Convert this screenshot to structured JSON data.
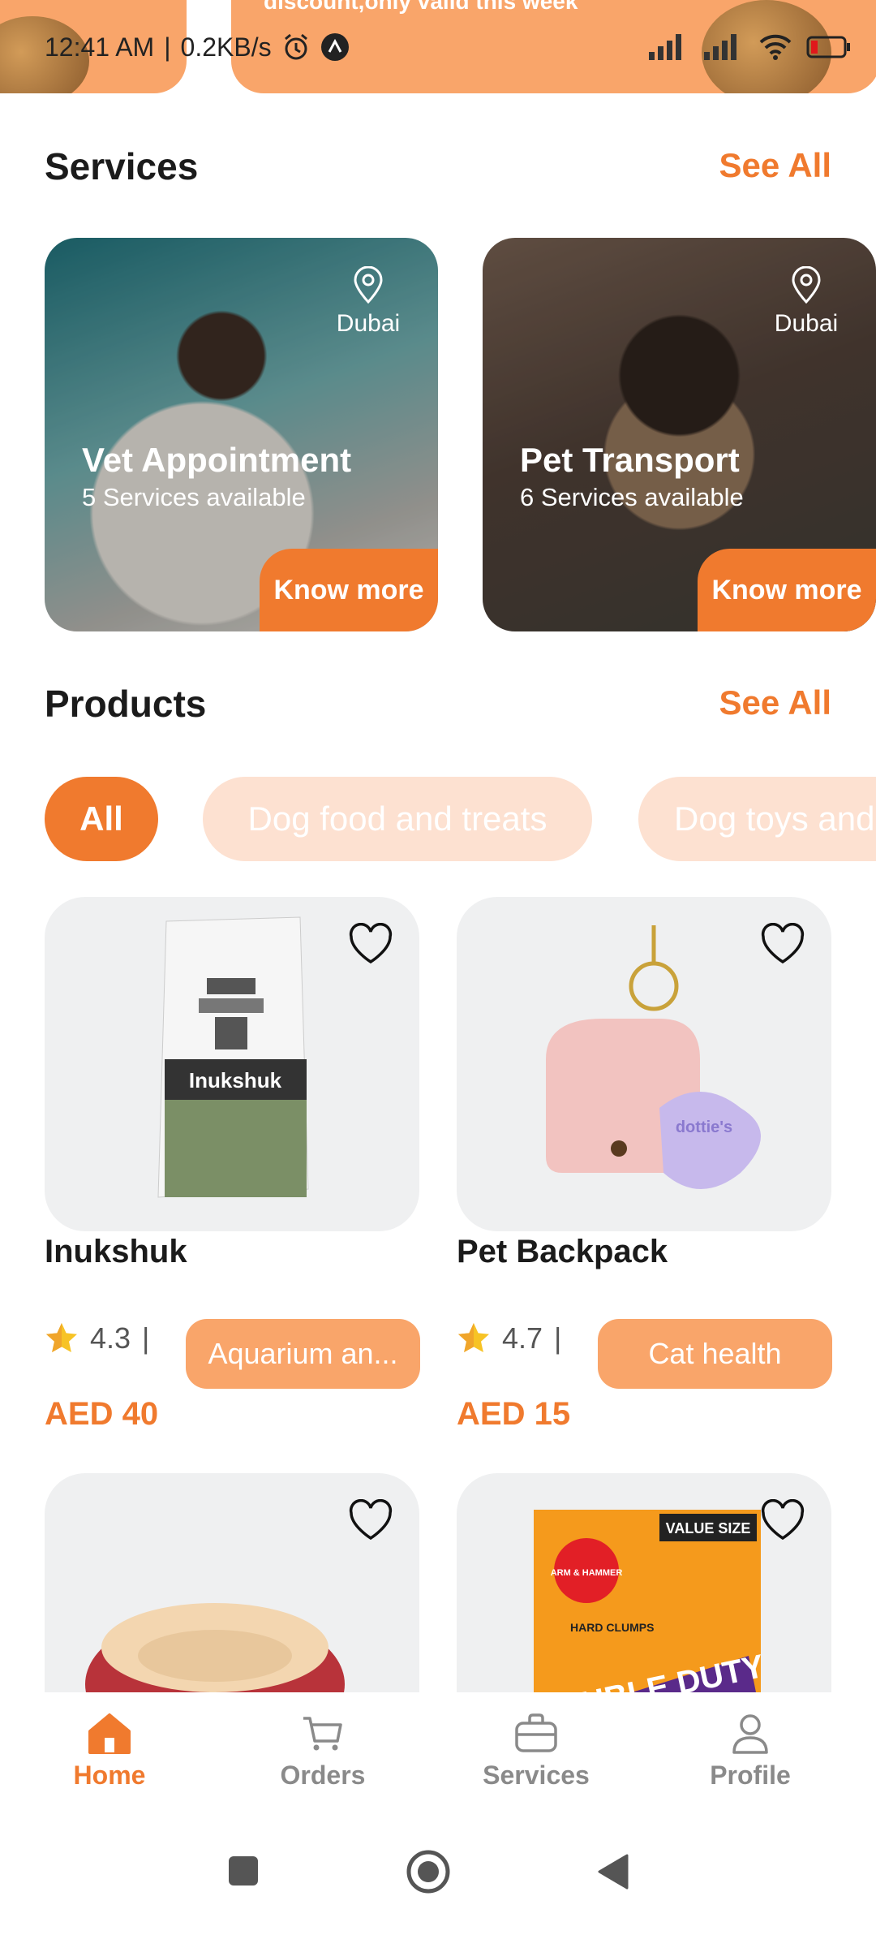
{
  "banner": {
    "text": "discount,only valid this week"
  },
  "status_bar": {
    "time": "12:41 AM",
    "speed": "0.2KB/s"
  },
  "services": {
    "title": "Services",
    "see_all": "See All",
    "cards": [
      {
        "title": "Vet Appointment",
        "subtitle": "5 Services available",
        "location": "Dubai",
        "button": "Know more"
      },
      {
        "title": "Pet Transport",
        "subtitle": "6 Services available",
        "location": "Dubai",
        "button": "Know more"
      }
    ]
  },
  "products": {
    "title": "Products",
    "see_all": "See All",
    "chips": [
      "All",
      "Dog food and treats",
      "Dog toys and accessories"
    ],
    "items": [
      {
        "name": "Inukshuk",
        "rating": "4.3",
        "category": "Aquarium an...",
        "price": "AED 40",
        "label": "Inukshuk"
      },
      {
        "name": "Pet Backpack",
        "rating": "4.7",
        "category": "Cat health",
        "price": "AED 15",
        "label": "dottie's"
      }
    ],
    "partial_labels": {
      "box_top": "VALUE SIZE",
      "box_brand": "ARM & HAMMER",
      "box_name": "DOUBLE DUTY",
      "box_side": "HARD CLUMPS"
    }
  },
  "bottom_nav": [
    "Home",
    "Orders",
    "Services",
    "Profile"
  ],
  "colors": {
    "accent": "#f07a2e",
    "accent_light": "#f9a56a",
    "chip_inactive": "#fde1d1",
    "card_bg": "#eff0f1"
  }
}
